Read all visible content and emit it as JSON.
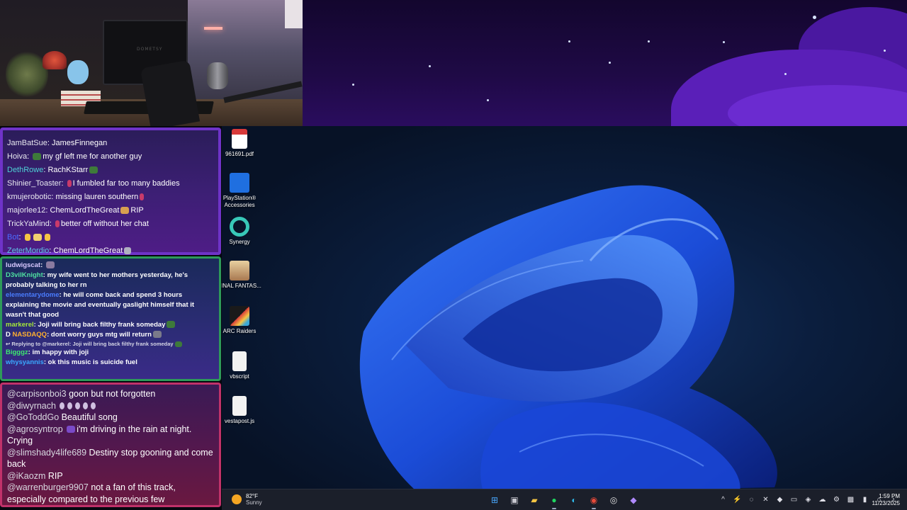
{
  "chat_top": [
    {
      "user": "JamBatSue",
      "text": "JamesFinnegan",
      "user_color": "default"
    },
    {
      "user": "Hoiva",
      "text": "my gf left me for another guy",
      "user_color": "default"
    },
    {
      "user": "DethRowe",
      "text": "RachKStarr",
      "user_color": "teal"
    },
    {
      "user": "Shinier_Toaster",
      "text": "I fumbled far too many baddies",
      "user_color": "default"
    },
    {
      "user": "kmujerobotic",
      "text": "missing lauren southern",
      "user_color": "default"
    },
    {
      "user": "majorlee12",
      "text": "ChemLordTheGreat",
      "suffix": "RIP",
      "user_color": "default"
    },
    {
      "user": "TrickYaMind",
      "text": "better off without her chat",
      "user_color": "default"
    },
    {
      "user": "Bot",
      "text": "",
      "user_color": "blue"
    },
    {
      "user": "ZeterMordio",
      "text": "ChemLordTheGreat",
      "user_color": "cyan"
    }
  ],
  "chat_middle": [
    {
      "user": "ludwigscat",
      "text": "",
      "color": "#d8c8ff"
    },
    {
      "user": "D3vilKnight",
      "text": "my wife went to her mothers yesterday, he's probably talking to her rn",
      "color": "#4fe0a0"
    },
    {
      "user": "elementarydome",
      "text": "he will come back and spend 3 hours explaining the movie and eventually gaslight himself that it wasn't that good",
      "color": "#4a7cff"
    },
    {
      "user": "markerel",
      "text": "Joji will bring back filthy frank someday",
      "color": "#a6e83a"
    },
    {
      "user": "NASDAQQ",
      "text": "dont worry guys mtg will return",
      "color": "#ffb030",
      "badge": "D"
    },
    {
      "reply": "Replying to @markerel: Joji will bring back filthy frank someday"
    },
    {
      "user": "Bigggz",
      "text": "im happy with joji",
      "color": "#3ee870"
    },
    {
      "user": "whysyannis",
      "text": "ok this music is suicide fuel",
      "color": "#3aa8ff"
    }
  ],
  "chat_bottom": [
    {
      "user": "@carpisonboi3",
      "text": "goon but not forgotten"
    },
    {
      "user": "@diwyrnach",
      "text": ""
    },
    {
      "user": "@GoToddGo",
      "text": "Beautiful song"
    },
    {
      "user": "@agrosyntrop",
      "text": "i'm driving in the rain at night. Crying"
    },
    {
      "user": "@slimshady4life689",
      "text": "Destiny stop gooning and come back"
    },
    {
      "user": "@iKaozm",
      "text": "RIP"
    },
    {
      "user": "@warrenburger9907",
      "text": "not a fan of this track, especially compared to the previous few"
    }
  ],
  "desktop_icons": [
    {
      "label": "961691.pdf",
      "icon": "pdf-file-icon",
      "color": "#d83a3a"
    },
    {
      "label": "PlayStation® Accessories",
      "icon": "playstation-accessories-icon",
      "color": "#1f6fe0"
    },
    {
      "label": "Synergy",
      "icon": "synergy-icon",
      "color": "#38c8b8"
    },
    {
      "label": "FINAL FANTAS...",
      "icon": "final-fantasy-icon",
      "color": "#c8a070"
    },
    {
      "label": "ARC Raiders",
      "icon": "arc-raiders-icon",
      "color": "#1a1a1a"
    },
    {
      "label": "vbscript",
      "icon": "script-file-icon",
      "color": "#f2f2f2"
    },
    {
      "label": "vestapost.js",
      "icon": "js-file-icon",
      "color": "#f2f2f2"
    }
  ],
  "taskbar": {
    "weather_temp": "82°F",
    "weather_cond": "Sunny",
    "apps": [
      {
        "name": "start-icon",
        "glyph": "⊞",
        "color": "#4aa8ff",
        "active": false
      },
      {
        "name": "task-view-icon",
        "glyph": "▣",
        "color": "#c8c8d0",
        "active": false
      },
      {
        "name": "file-explorer-icon",
        "glyph": "▰",
        "color": "#f5c543",
        "active": false
      },
      {
        "name": "spotify-icon",
        "glyph": "●",
        "color": "#1ed760",
        "active": true
      },
      {
        "name": "edge-icon",
        "glyph": "◐",
        "color": "#2fb8e8",
        "active": false
      },
      {
        "name": "chrome-icon",
        "glyph": "◉",
        "color": "#e84a3a",
        "active": true
      },
      {
        "name": "obs-icon",
        "glyph": "◎",
        "color": "#e0e0e0",
        "active": false
      },
      {
        "name": "crystal-app-icon",
        "glyph": "◆",
        "color": "#b08aff",
        "active": false
      }
    ],
    "tray": [
      {
        "name": "chevron-up-icon",
        "glyph": "^"
      },
      {
        "name": "bolt-icon",
        "glyph": "⚡"
      },
      {
        "name": "sync-icon",
        "glyph": "◌"
      },
      {
        "name": "mute-icon",
        "glyph": "✕"
      },
      {
        "name": "app-tray-icon",
        "glyph": "◆"
      },
      {
        "name": "tablet-icon",
        "glyph": "▭"
      },
      {
        "name": "steam-icon",
        "glyph": "◈"
      },
      {
        "name": "cloud-icon",
        "glyph": "☁"
      },
      {
        "name": "settings-icon",
        "glyph": "⚙"
      },
      {
        "name": "nvidia-icon",
        "glyph": "▩"
      },
      {
        "name": "battery-icon",
        "glyph": "▮"
      },
      {
        "name": "network-icon",
        "glyph": "⌂"
      },
      {
        "name": "volume-icon",
        "glyph": "♪"
      }
    ],
    "time": "1:59 PM",
    "date": "11/23/2025"
  }
}
